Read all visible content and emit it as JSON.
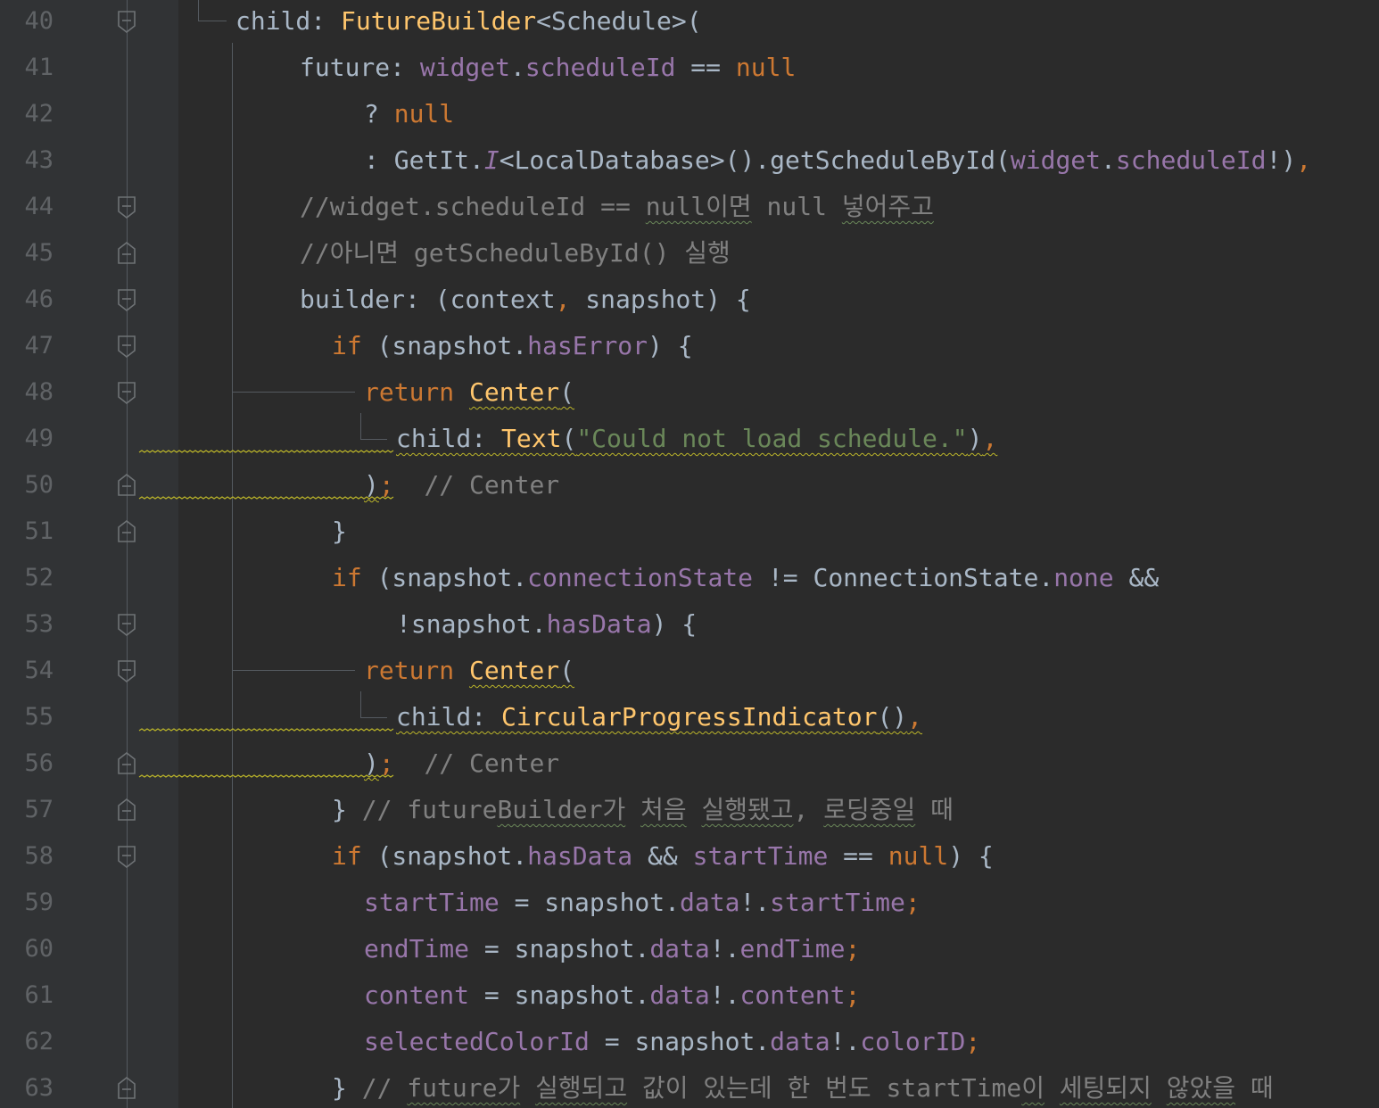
{
  "editor": {
    "background": "#2b2b2b",
    "lines": [
      {
        "n": "40",
        "indent": 264,
        "fold": "open",
        "tokens": [
          [
            "def",
            "child: "
          ],
          [
            "cls",
            "FutureBuilder"
          ],
          [
            "def",
            "<Schedule>("
          ]
        ]
      },
      {
        "n": "41",
        "indent": 336,
        "fold": "none",
        "tokens": [
          [
            "def",
            "future: "
          ],
          [
            "field",
            "widget"
          ],
          [
            "def",
            "."
          ],
          [
            "field",
            "scheduleId"
          ],
          [
            "def",
            " == "
          ],
          [
            "kw",
            "null"
          ]
        ]
      },
      {
        "n": "42",
        "indent": 408,
        "fold": "none",
        "tokens": [
          [
            "def",
            "? "
          ],
          [
            "kw",
            "null"
          ]
        ]
      },
      {
        "n": "43",
        "indent": 408,
        "fold": "none",
        "tokens": [
          [
            "def",
            ": GetIt."
          ],
          [
            "italic",
            "I"
          ],
          [
            "def",
            "<LocalDatabase>().getScheduleById("
          ],
          [
            "field",
            "widget"
          ],
          [
            "def",
            "."
          ],
          [
            "field",
            "scheduleId"
          ],
          [
            "def",
            "!)"
          ],
          [
            "kw",
            ","
          ]
        ]
      },
      {
        "n": "44",
        "indent": 336,
        "fold": "open",
        "tokens": [
          [
            "cmt",
            "//widget.scheduleId == "
          ],
          [
            "cmtw",
            "null이면"
          ],
          [
            "cmt",
            " null "
          ],
          [
            "cmtw",
            "넣어주고"
          ]
        ]
      },
      {
        "n": "45",
        "indent": 336,
        "fold": "close",
        "tokens": [
          [
            "cmt",
            "//아니면 getScheduleById() 실행"
          ]
        ]
      },
      {
        "n": "46",
        "indent": 336,
        "fold": "open",
        "tokens": [
          [
            "def",
            "builder: (context"
          ],
          [
            "kw",
            ","
          ],
          [
            "def",
            " snapshot) {"
          ]
        ]
      },
      {
        "n": "47",
        "indent": 372,
        "fold": "open",
        "tokens": [
          [
            "kw",
            "if"
          ],
          [
            "def",
            " (snapshot."
          ],
          [
            "field",
            "hasError"
          ],
          [
            "def",
            ") {"
          ]
        ]
      },
      {
        "n": "48",
        "indent": 408,
        "fold": "open",
        "tokens": [
          [
            "kw",
            "return "
          ],
          [
            "clsw",
            "Center"
          ],
          [
            "defw",
            "("
          ]
        ]
      },
      {
        "n": "49",
        "indent": 444,
        "fold": "none",
        "tokens": [
          [
            "defw",
            "child: "
          ],
          [
            "clsw",
            "Text"
          ],
          [
            "defw",
            "("
          ],
          [
            "strw",
            "\"Could not load schedule.\""
          ],
          [
            "defw",
            ")"
          ],
          [
            "kww",
            ","
          ]
        ]
      },
      {
        "n": "50",
        "indent": 408,
        "fold": "close",
        "tokens": [
          [
            "defw",
            ")"
          ],
          [
            "kw",
            ";"
          ],
          [
            "def",
            "  "
          ],
          [
            "cmt",
            "// Center"
          ]
        ]
      },
      {
        "n": "51",
        "indent": 372,
        "fold": "close",
        "tokens": [
          [
            "def",
            "}"
          ]
        ]
      },
      {
        "n": "52",
        "indent": 372,
        "fold": "none",
        "tokens": [
          [
            "kw",
            "if"
          ],
          [
            "def",
            " (snapshot."
          ],
          [
            "field",
            "connectionState"
          ],
          [
            "def",
            " != ConnectionState."
          ],
          [
            "field",
            "none"
          ],
          [
            "def",
            " &&"
          ]
        ]
      },
      {
        "n": "53",
        "indent": 444,
        "fold": "open",
        "tokens": [
          [
            "def",
            "!snapshot."
          ],
          [
            "field",
            "hasData"
          ],
          [
            "def",
            ") {"
          ]
        ]
      },
      {
        "n": "54",
        "indent": 408,
        "fold": "open",
        "tokens": [
          [
            "kw",
            "return "
          ],
          [
            "clsw",
            "Center"
          ],
          [
            "defw",
            "("
          ]
        ]
      },
      {
        "n": "55",
        "indent": 444,
        "fold": "none",
        "tokens": [
          [
            "defw",
            "child: "
          ],
          [
            "clsw",
            "CircularProgressIndicator"
          ],
          [
            "defw",
            "()"
          ],
          [
            "kww",
            ","
          ]
        ]
      },
      {
        "n": "56",
        "indent": 408,
        "fold": "close",
        "tokens": [
          [
            "defw",
            ")"
          ],
          [
            "kw",
            ";"
          ],
          [
            "def",
            "  "
          ],
          [
            "cmt",
            "// Center"
          ]
        ]
      },
      {
        "n": "57",
        "indent": 372,
        "fold": "close",
        "tokens": [
          [
            "def",
            "} "
          ],
          [
            "cmt",
            "// future"
          ],
          [
            "cmtw",
            "Builder가"
          ],
          [
            "cmt",
            " "
          ],
          [
            "cmtw",
            "처음"
          ],
          [
            "cmt",
            " "
          ],
          [
            "cmtw",
            "실행됐고"
          ],
          [
            "cmt",
            ", "
          ],
          [
            "cmtw",
            "로딩중일"
          ],
          [
            "cmt",
            " 때"
          ]
        ]
      },
      {
        "n": "58",
        "indent": 372,
        "fold": "open",
        "tokens": [
          [
            "kw",
            "if"
          ],
          [
            "def",
            " (snapshot."
          ],
          [
            "field",
            "hasData"
          ],
          [
            "def",
            " && "
          ],
          [
            "field",
            "startTime"
          ],
          [
            "def",
            " == "
          ],
          [
            "kw",
            "null"
          ],
          [
            "def",
            ") {"
          ]
        ]
      },
      {
        "n": "59",
        "indent": 408,
        "fold": "none",
        "tokens": [
          [
            "field",
            "startTime"
          ],
          [
            "def",
            " = snapshot."
          ],
          [
            "field",
            "data"
          ],
          [
            "def",
            "!."
          ],
          [
            "field",
            "startTime"
          ],
          [
            "kw",
            ";"
          ]
        ]
      },
      {
        "n": "60",
        "indent": 408,
        "fold": "none",
        "tokens": [
          [
            "field",
            "endTime"
          ],
          [
            "def",
            " = snapshot."
          ],
          [
            "field",
            "data"
          ],
          [
            "def",
            "!."
          ],
          [
            "field",
            "endTime"
          ],
          [
            "kw",
            ";"
          ]
        ]
      },
      {
        "n": "61",
        "indent": 408,
        "fold": "none",
        "tokens": [
          [
            "field",
            "content"
          ],
          [
            "def",
            " = snapshot."
          ],
          [
            "field",
            "data"
          ],
          [
            "def",
            "!."
          ],
          [
            "field",
            "content"
          ],
          [
            "kw",
            ";"
          ]
        ]
      },
      {
        "n": "62",
        "indent": 408,
        "fold": "none",
        "tokens": [
          [
            "field",
            "selectedColorId"
          ],
          [
            "def",
            " = snapshot."
          ],
          [
            "field",
            "data"
          ],
          [
            "def",
            "!."
          ],
          [
            "field",
            "colorID"
          ],
          [
            "kw",
            ";"
          ]
        ]
      },
      {
        "n": "63",
        "indent": 372,
        "fold": "close",
        "tokens": [
          [
            "def",
            "} "
          ],
          [
            "cmt",
            "// "
          ],
          [
            "cmtw",
            "future가"
          ],
          [
            "cmt",
            " "
          ],
          [
            "cmtw",
            "실행되고"
          ],
          [
            "cmt",
            " 값이 있는데 한 번도 startTime"
          ],
          [
            "cmtw",
            "이"
          ],
          [
            "cmt",
            " "
          ],
          [
            "cmtw",
            "세팅되지"
          ],
          [
            "cmt",
            " "
          ],
          [
            "cmtw",
            "않았을"
          ],
          [
            "cmt",
            " 때"
          ]
        ]
      }
    ]
  }
}
